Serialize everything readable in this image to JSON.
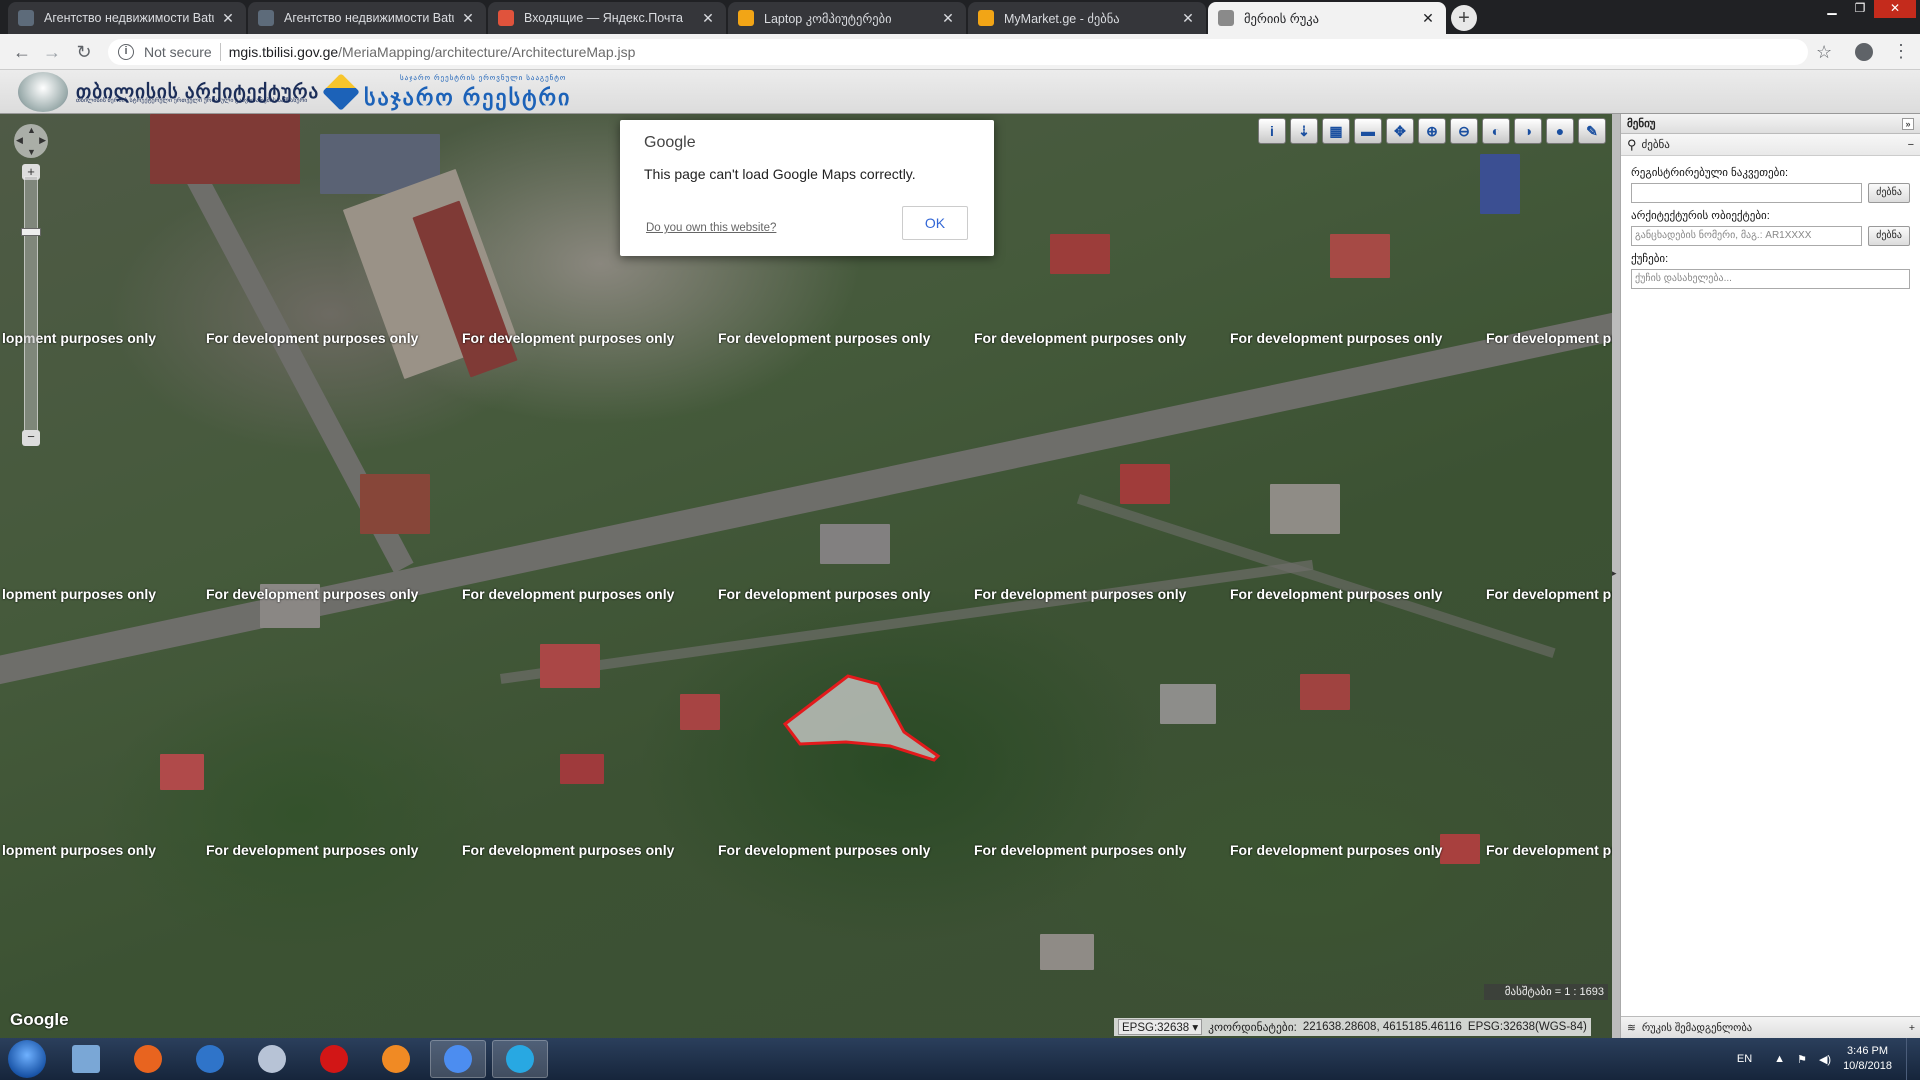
{
  "browser": {
    "tabs": [
      {
        "title": "Агентство недвижимости Batumi",
        "icon": "house-favicon",
        "color": "#5d6b7a"
      },
      {
        "title": "Агентство недвижимости Batumi",
        "icon": "house-favicon",
        "color": "#5d6b7a"
      },
      {
        "title": "Входящие — Яндекс.Почта",
        "icon": "mail-favicon",
        "color": "#e0533c"
      },
      {
        "title": "Laptop კომპიუტერები",
        "icon": "mymarket-favicon",
        "color": "#f2a516"
      },
      {
        "title": "MyMarket.ge - ძებნა",
        "icon": "mymarket-favicon",
        "color": "#f2a516"
      },
      {
        "title": "მერიის რუკა",
        "icon": "globe-favicon",
        "color": "#8a8a8a",
        "active": true
      }
    ],
    "close_glyph": "✕",
    "new_tab_glyph": "+",
    "security_label": "Not secure",
    "url_host": "mgis.tbilisi.gov.ge",
    "url_path": "/MeriaMapping/architecture/ArchitectureMap.jsp"
  },
  "site": {
    "logo_left_title": "თბილისის არქიტექტურა",
    "logo_left_sub": "თბილისის მერიის სტრუქტურული ერთეული ურბანული განვითარების სამსახური",
    "logo_right_sub": "საჯარო რეესტრის ეროვნული სააგენტო",
    "logo_right_title": "საჯარო რეესტრი"
  },
  "map": {
    "watermark": "For development purposes only",
    "watermark_clipped": "lopment purposes only",
    "watermark_cut": "For development pu",
    "google_logo": "Google",
    "scale_text": "მასშტაბი = 1 : 1693",
    "epsg_select": "EPSG:32638",
    "coords_label": "კოორდინატები:",
    "coords_value": "221638.28608, 4615185.46116",
    "coords_crs": "EPSG:32638(WGS-84)",
    "tool_icons": [
      "info-icon",
      "identify-icon",
      "layers-icon",
      "measure-icon",
      "pan-icon",
      "zoom-in-icon",
      "zoom-out-icon",
      "zoom-prev-icon",
      "zoom-next-icon",
      "globe-icon",
      "edit-icon"
    ]
  },
  "dialog": {
    "title": "Google",
    "message": "This page can't load Google Maps correctly.",
    "link": "Do you own this website?",
    "ok": "OK"
  },
  "panel": {
    "title": "მენიუ",
    "search_header": "ძებნა",
    "cadastral_label": "რეგისტრირებული ნაკვეთები:",
    "cadastral_placeholder": "",
    "cadastral_btn": "ძებნა",
    "arch_label": "არქიტექტურის ობიექტები:",
    "arch_placeholder": "განცხადების ნომერი, მაგ.: AR1XXXX",
    "arch_btn": "ძებნა",
    "street_label": "ქუჩები:",
    "street_placeholder": "ქუჩის დასახელება...",
    "footer": "რუკის შემადგენლობა"
  },
  "taskbar": {
    "apps": [
      "explorer-icon",
      "firefox-icon",
      "ie-icon",
      "paint-icon",
      "opera-icon",
      "media-player-icon",
      "chrome-icon",
      "skype-icon"
    ],
    "lang": "EN",
    "time": "3:46 PM",
    "date": "10/8/2018"
  }
}
